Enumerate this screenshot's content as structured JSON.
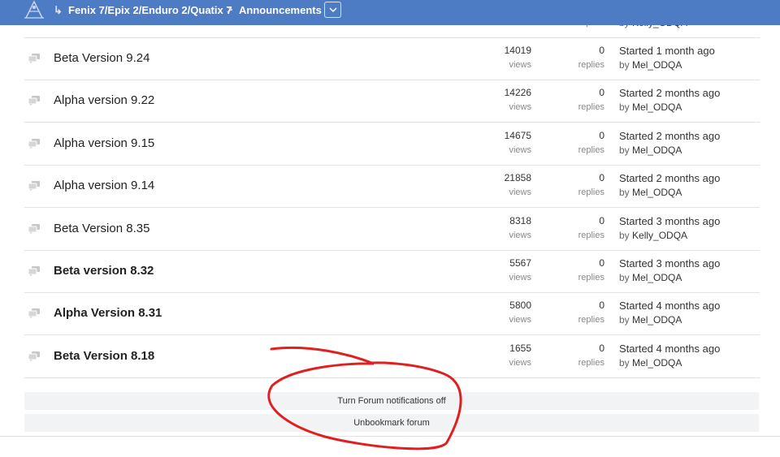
{
  "header": {
    "breadcrumb_arrow": "↳",
    "forum_name": "Fenix 7/Epix 2/Enduro 2/Quatix 7",
    "separator": ">",
    "current": "Announcements"
  },
  "partial_row": {
    "views_label": "views",
    "replies_label": "replies",
    "by_prefix": "by",
    "author": "Kelly_ODQA"
  },
  "threads": [
    {
      "title": "Beta Version 9.24",
      "bold": false,
      "views": "14019",
      "replies": "0",
      "started": "Started 1 month ago",
      "author": "Mel_ODQA"
    },
    {
      "title": "Alpha version 9.22",
      "bold": false,
      "views": "14226",
      "replies": "0",
      "started": "Started 2 months ago",
      "author": "Mel_ODQA"
    },
    {
      "title": "Alpha version 9.15",
      "bold": false,
      "views": "14675",
      "replies": "0",
      "started": "Started 2 months ago",
      "author": "Mel_ODQA"
    },
    {
      "title": "Alpha version 9.14",
      "bold": false,
      "views": "21858",
      "replies": "0",
      "started": "Started 2 months ago",
      "author": "Mel_ODQA"
    },
    {
      "title": "Beta Version 8.35",
      "bold": false,
      "views": "8318",
      "replies": "0",
      "started": "Started 3 months ago",
      "author": "Kelly_ODQA"
    },
    {
      "title": "Beta version 8.32",
      "bold": true,
      "views": "5567",
      "replies": "0",
      "started": "Started 3 months ago",
      "author": "Mel_ODQA"
    },
    {
      "title": "Alpha Version 8.31",
      "bold": true,
      "views": "5800",
      "replies": "0",
      "started": "Started 4 months ago",
      "author": "Mel_ODQA"
    },
    {
      "title": "Beta Version 8.18",
      "bold": true,
      "views": "1655",
      "replies": "0",
      "started": "Started 4 months ago",
      "author": "Mel_ODQA"
    }
  ],
  "labels": {
    "views": "views",
    "replies": "replies",
    "by": "by"
  },
  "actions": {
    "notifications": "Turn Forum notifications off",
    "bookmark": "Unbookmark forum"
  },
  "colors": {
    "header_bg": "#4e7cc4",
    "annotation": "#e02020"
  }
}
